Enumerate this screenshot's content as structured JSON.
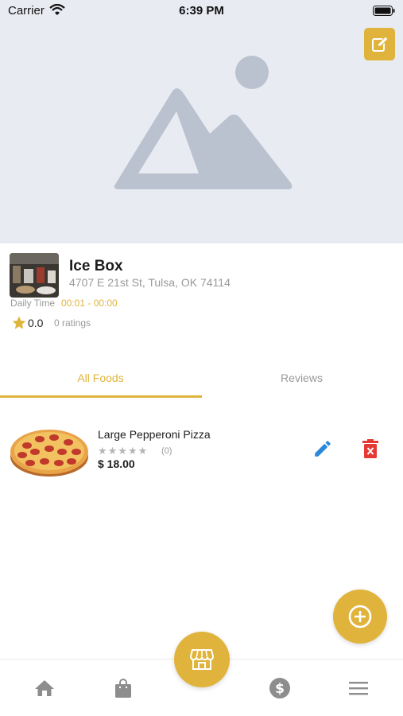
{
  "status_bar": {
    "carrier": "Carrier",
    "time": "6:39 PM"
  },
  "cover": {
    "placeholder_icon": "image-placeholder-icon",
    "edit_icon": "edit-icon"
  },
  "store": {
    "name": "Ice Box",
    "address": "4707 E 21st St, Tulsa, OK 74114",
    "daily_time_label": "Daily Time",
    "daily_time_value": "00:01 - 00:00",
    "rating_value": "0.0",
    "rating_count": "0 ratings"
  },
  "tabs": [
    {
      "label": "All Foods",
      "active": true
    },
    {
      "label": "Reviews",
      "active": false
    }
  ],
  "foods": [
    {
      "name": "Large Pepperoni Pizza",
      "stars": "★★★★★",
      "review_count": "(0)",
      "price": "$ 18.00"
    }
  ],
  "bottom_nav": {
    "items": [
      "home-icon",
      "shopping-bag-icon",
      "store-icon",
      "dollar-icon",
      "menu-icon"
    ]
  },
  "colors": {
    "accent": "#e0b43c",
    "edit_blue": "#2b88d8",
    "delete_red": "#e53935"
  }
}
